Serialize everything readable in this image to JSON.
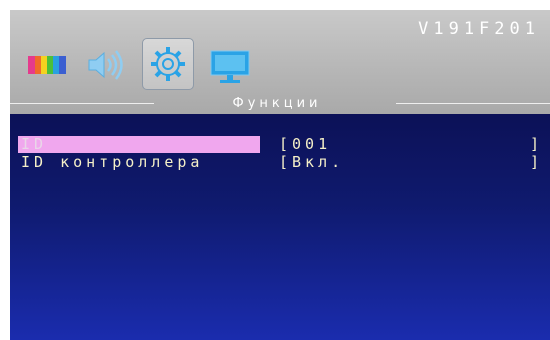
{
  "header": {
    "model": "V191F201",
    "tabs": [
      {
        "icon": "color-bars-icon",
        "selected": false
      },
      {
        "icon": "speaker-icon",
        "selected": false
      },
      {
        "icon": "gear-icon",
        "selected": true
      },
      {
        "icon": "monitor-icon",
        "selected": false
      }
    ],
    "section_title": "Функции"
  },
  "menu": {
    "items": [
      {
        "label": "ID",
        "value": "[001",
        "close": "]",
        "selected": true
      },
      {
        "label": "ID контроллера",
        "value": "[Вкл.",
        "close": "]",
        "selected": false
      }
    ]
  },
  "colors": {
    "header_gray": "#b7b7b7",
    "menu_blue": "#0f1a6e",
    "highlight_pink": "#f0a7ee",
    "text_cream": "#f5f0c8",
    "icon_blue": "#2aa3e6"
  }
}
